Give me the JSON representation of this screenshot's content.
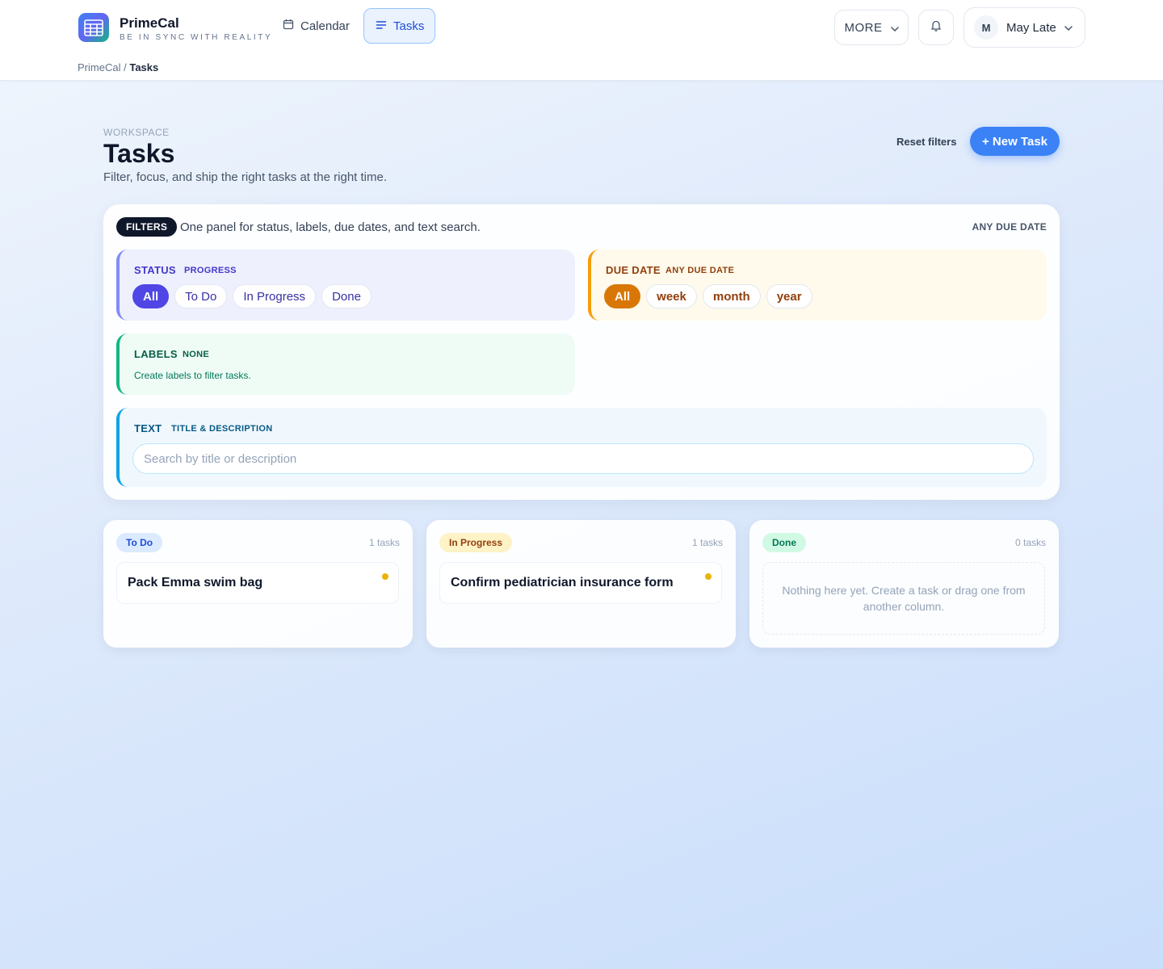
{
  "app": {
    "name": "PrimeCal",
    "tagline": "BE IN SYNC WITH REALITY"
  },
  "nav": {
    "calendar": "Calendar",
    "tasks": "Tasks",
    "more": "MORE"
  },
  "user": {
    "initial": "M",
    "name": "May Late"
  },
  "breadcrumb": {
    "root": "PrimeCal",
    "separator": "/",
    "current": "Tasks"
  },
  "page": {
    "eyebrow": "WORKSPACE",
    "title": "Tasks",
    "subtitle": "Filter, focus, and ship the right tasks at the right time.",
    "reset_label": "Reset filters",
    "new_task_label": "+ New Task"
  },
  "filters": {
    "badge": "FILTERS",
    "description": "One panel for status, labels, due dates, and text search.",
    "summary": "ANY DUE DATE",
    "status": {
      "title": "STATUS",
      "tag": "PROGRESS",
      "options": [
        "All",
        "To Do",
        "In Progress",
        "Done"
      ],
      "selected": "All"
    },
    "due_date": {
      "title": "DUE DATE",
      "tag": "ANY DUE DATE",
      "options": [
        "All",
        "week",
        "month",
        "year"
      ],
      "selected": "All"
    },
    "labels": {
      "title": "LABELS",
      "tag": "NONE",
      "hint": "Create labels to filter tasks."
    },
    "text": {
      "title": "TEXT",
      "tag": "TITLE & DESCRIPTION",
      "value": "",
      "placeholder": "Search by title or description"
    }
  },
  "columns": [
    {
      "name": "To Do",
      "count": "1 tasks",
      "tasks": [
        "Pack Emma swim bag"
      ]
    },
    {
      "name": "In Progress",
      "count": "1 tasks",
      "tasks": [
        "Confirm pediatrician insurance form"
      ]
    },
    {
      "name": "Done",
      "count": "0 tasks",
      "tasks": [],
      "empty_text": "Nothing here yet. Create a task or drag one from another column."
    }
  ],
  "colors": {
    "accent": "#3b82f6",
    "status_active": "#4f46e5",
    "due_active": "#d97706",
    "priority_dot": "#eab308"
  },
  "icons": {
    "logo": "calendar-grid-icon",
    "calendar": "calendar-icon",
    "tasks": "list-icon",
    "more": "chevron-down-icon",
    "notifications": "bell-icon",
    "user_menu": "chevron-down-icon"
  }
}
